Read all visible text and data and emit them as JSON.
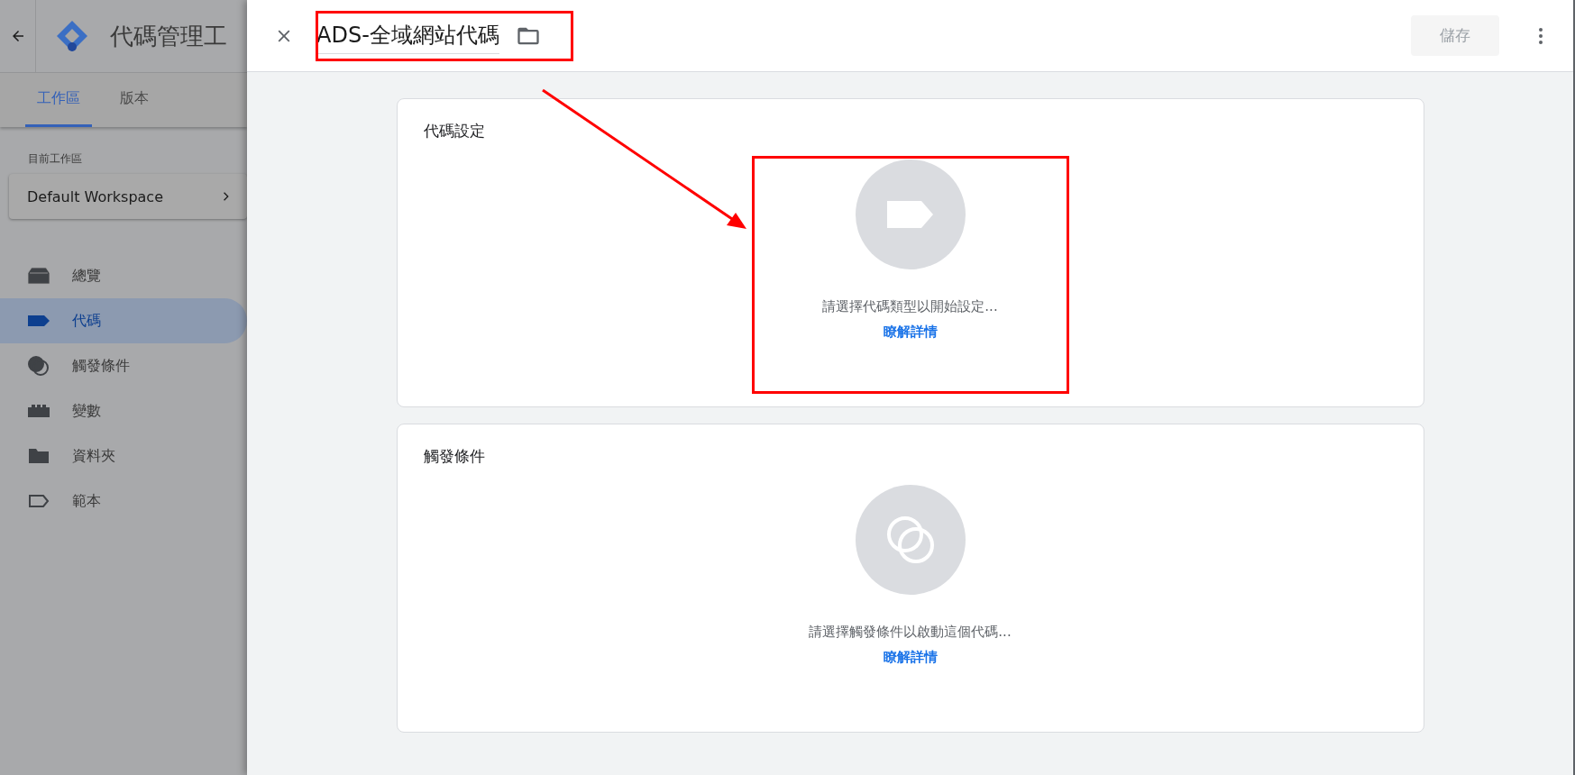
{
  "app_header": {
    "title": "代碼管理工"
  },
  "tabs": [
    {
      "label": "工作區",
      "selected": true
    },
    {
      "label": "版本",
      "selected": false
    }
  ],
  "workspace": {
    "label": "目前工作區",
    "name": "Default Workspace"
  },
  "nav": [
    {
      "label": "總覽",
      "kind": "overview",
      "selected": false
    },
    {
      "label": "代碼",
      "kind": "tag",
      "selected": true
    },
    {
      "label": "觸發條件",
      "kind": "trigger",
      "selected": false
    },
    {
      "label": "變數",
      "kind": "variable",
      "selected": false
    },
    {
      "label": "資料夾",
      "kind": "folder",
      "selected": false
    },
    {
      "label": "範本",
      "kind": "template",
      "selected": false
    }
  ],
  "editor": {
    "title": "ADS-全域網站代碼",
    "save_label": "儲存",
    "save_disabled": true,
    "sections": [
      {
        "kind": "tag",
        "title": "代碼設定",
        "hint": "請選擇代碼類型以開始設定...",
        "link": "瞭解詳情"
      },
      {
        "kind": "trigger",
        "title": "觸發條件",
        "hint": "請選擇觸發條件以啟動這個代碼...",
        "link": "瞭解詳情"
      }
    ]
  }
}
